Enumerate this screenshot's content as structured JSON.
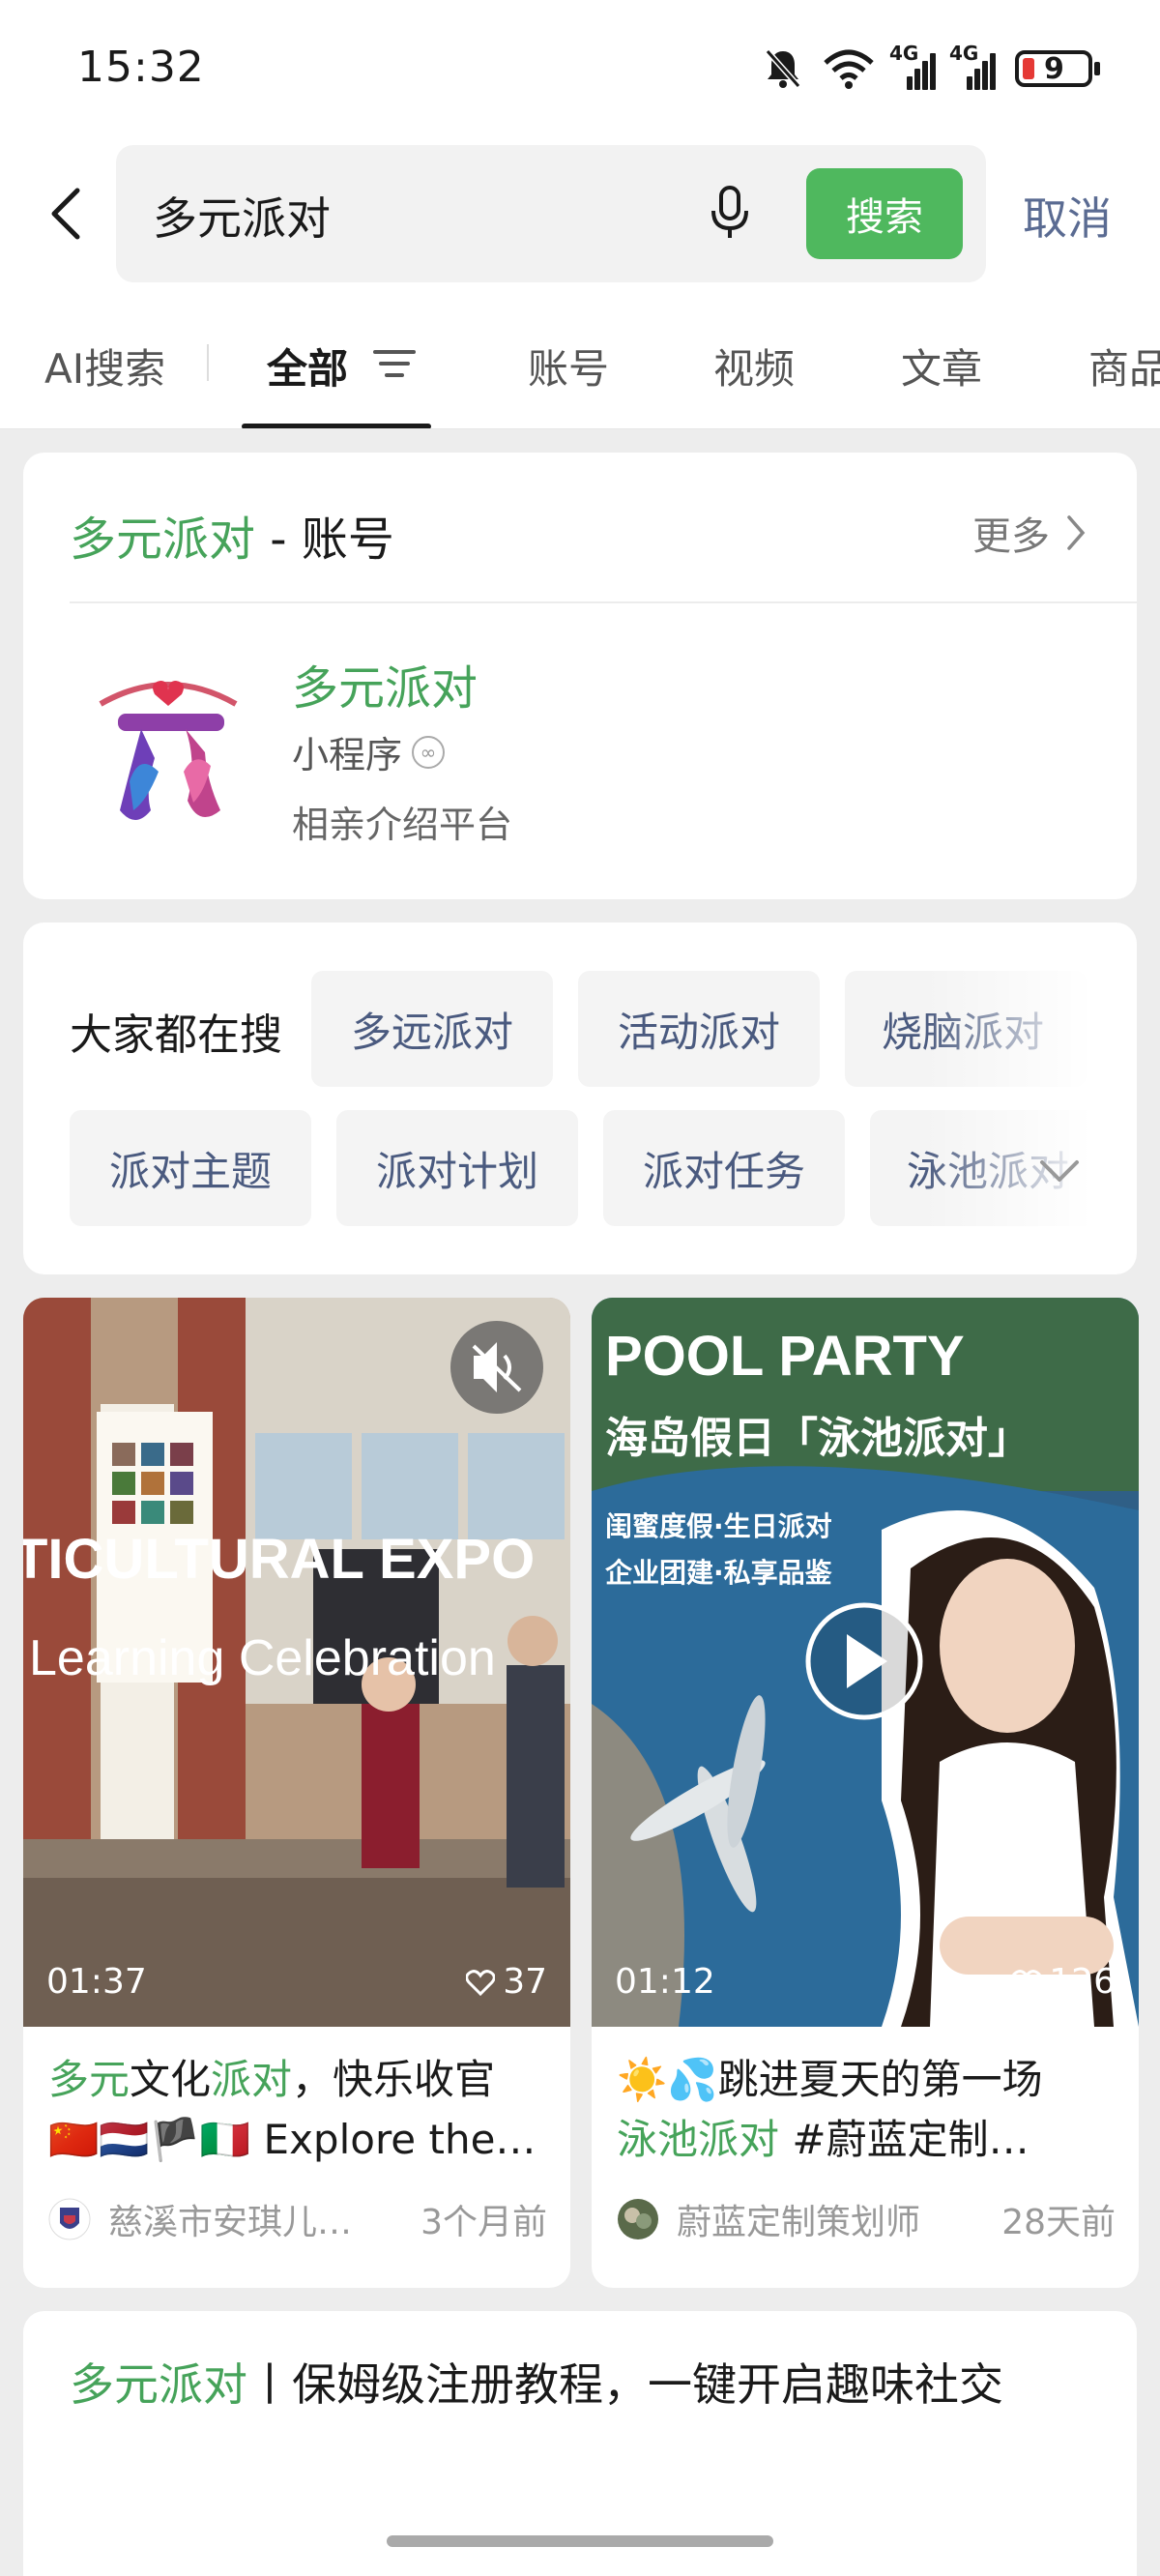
{
  "status_bar": {
    "time": "15:32",
    "battery": "9",
    "signal_1": "4G",
    "signal_2": "4G"
  },
  "search": {
    "query": "多元派对",
    "button_label": "搜索",
    "cancel_label": "取消"
  },
  "tabs": [
    {
      "label": "AI搜索"
    },
    {
      "label": "全部"
    },
    {
      "label": "账号"
    },
    {
      "label": "视频"
    },
    {
      "label": "文章"
    },
    {
      "label": "商品"
    }
  ],
  "account_section": {
    "title_keyword": "多元派对",
    "title_suffix": " - 账号",
    "more_label": "更多",
    "name": "多元派对",
    "type": "小程序",
    "description": "相亲介绍平台"
  },
  "suggestions": {
    "label": "大家都在搜",
    "row1": [
      "多远派对",
      "活动派对",
      "烧脑派对"
    ],
    "row2": [
      "派对主题",
      "派对计划",
      "派对任务",
      "泳池派对"
    ]
  },
  "videos": [
    {
      "duration": "01:37",
      "likes": "37",
      "title_line1_parts": [
        "多元",
        "文化",
        "派对",
        "，快乐收官"
      ],
      "title_line2": "🇨🇳🇳🇱🏴🇮🇹 Explore the…",
      "author": "慈溪市安琪儿…",
      "time_ago": "3个月前",
      "overlay_text_1": "TICULTURAL EXPO",
      "overlay_text_2": "Learning Celebration"
    },
    {
      "duration": "01:12",
      "likes": "126",
      "title_line1": "☀️💦跳进夏天的第一场",
      "title_line2_parts": [
        "泳池",
        "派对",
        " #蔚蓝定制…"
      ],
      "author": "蔚蓝定制策划师",
      "time_ago": "28天前",
      "overlay_text_1": "POOL PARTY",
      "overlay_text_2": "海岛假日「泳池派对」",
      "overlay_text_3": "闺蜜度假·生日派对",
      "overlay_text_4": "企业团建·私享品鉴"
    }
  ],
  "article": {
    "title_keyword": "多元派对",
    "title_rest": "丨保姆级注册教程，一键开启趣味社交"
  },
  "colors": {
    "accent_green": "#46a35a",
    "button_green": "#4fb85e",
    "link_blue": "#5a6b92"
  }
}
